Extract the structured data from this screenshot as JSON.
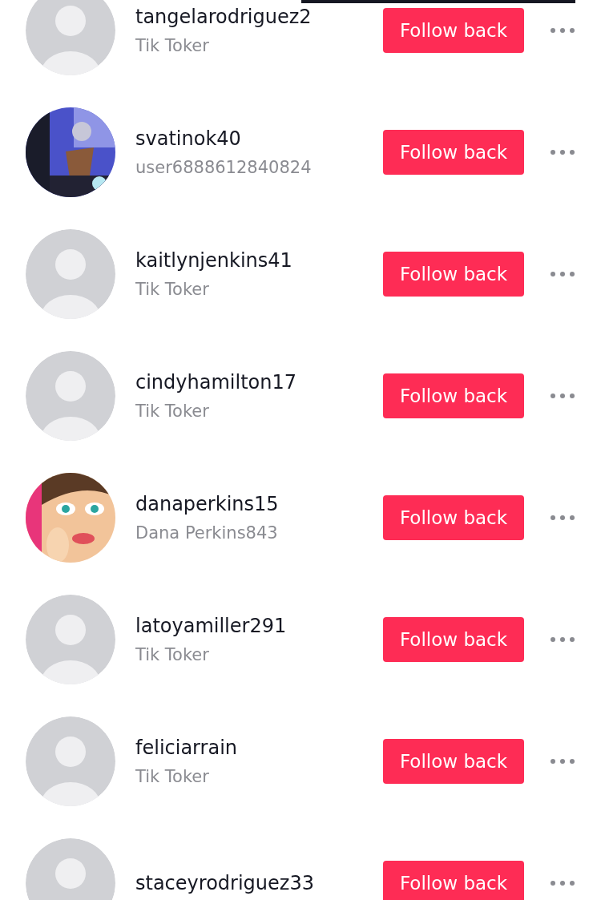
{
  "rows": [
    {
      "username": "tangelarodriguez2",
      "subtitle": "Tik Toker",
      "avatar": {
        "kind": "default"
      },
      "button": "Follow back"
    },
    {
      "username": "svatinok40",
      "subtitle": "user6888612840824",
      "button": "Follow back"
    },
    {
      "username": "kaitlynjenkins41",
      "subtitle": "Tik Toker",
      "avatar": {
        "kind": "default"
      },
      "button": "Follow back"
    },
    {
      "username": "cindyhamilton17",
      "subtitle": "Tik Toker",
      "avatar": {
        "kind": "default"
      },
      "button": "Follow back"
    },
    {
      "username": "danaperkins15",
      "subtitle": "Dana Perkins843",
      "button": "Follow back"
    },
    {
      "username": "latoyamiller291",
      "subtitle": "Tik Toker",
      "avatar": {
        "kind": "default"
      },
      "button": "Follow back"
    },
    {
      "username": "feliciarrain",
      "subtitle": "Tik Toker",
      "avatar": {
        "kind": "default"
      },
      "button": "Follow back"
    },
    {
      "username": "staceyrodriguez33",
      "avatar": {
        "kind": "default"
      },
      "button": "Follow back"
    }
  ]
}
